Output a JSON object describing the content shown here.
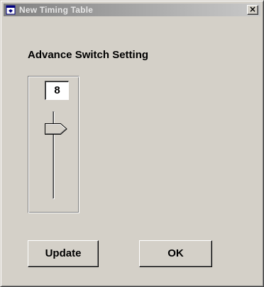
{
  "window": {
    "title": "New Timing Table",
    "close_label": "×"
  },
  "main": {
    "heading": "Advance Switch Setting",
    "slider": {
      "value": "8",
      "position_fraction": 0.2,
      "orientation": "vertical"
    },
    "buttons": {
      "update_label": "Update",
      "ok_label": "OK"
    }
  },
  "colors": {
    "face": "#d4d0c8",
    "titlebar_inactive_start": "#808080",
    "titlebar_inactive_end": "#c8c8c8"
  },
  "icons": {
    "title_icon": "window-icon",
    "slider_thumb": "slider-thumb-arrow"
  }
}
